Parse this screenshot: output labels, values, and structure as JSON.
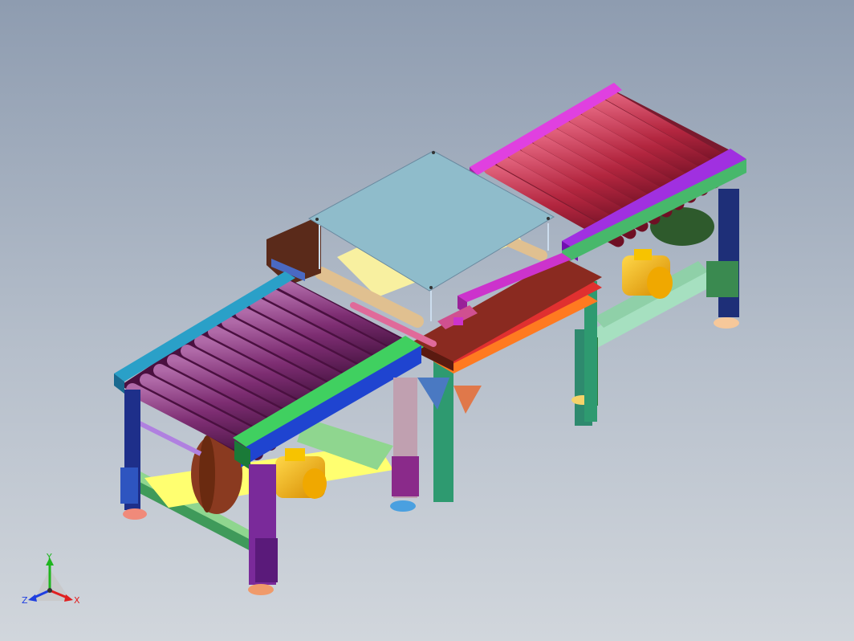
{
  "triad": {
    "y_label": "Y",
    "x_label": "X",
    "z_label": "Z",
    "colors": {
      "y": "#1fb51f",
      "x": "#e02020",
      "z": "#1f3fe0"
    }
  }
}
